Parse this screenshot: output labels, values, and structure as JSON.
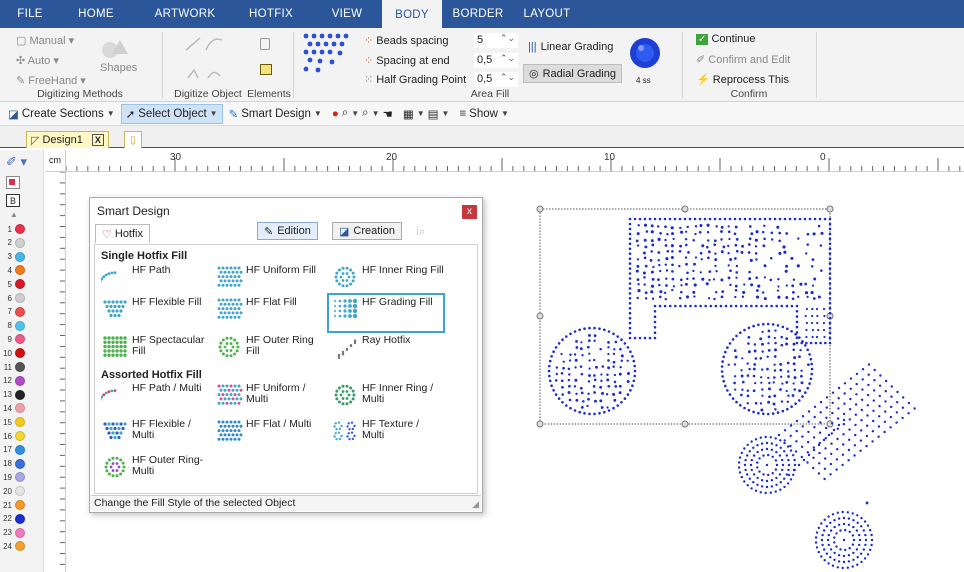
{
  "menu": {
    "tabs": [
      "FILE",
      "HOME",
      "ARTWORK",
      "HOTFIX",
      "VIEW",
      "BODY",
      "BORDER",
      "LAYOUT"
    ],
    "active": "BODY"
  },
  "ribbon": {
    "digitizing": {
      "manual": "Manual",
      "auto": "Auto",
      "freehand": "FreeHand",
      "shapes": "Shapes",
      "label": "Digitizing Methods"
    },
    "digitize_object_label": "Digitize Object",
    "elements_label": "Elements",
    "area_fill": {
      "beads_spacing_label": "Beads spacing",
      "beads_spacing_value": "5",
      "spacing_end_label": "Spacing at end",
      "spacing_end_value": "0,5",
      "half_grading_label": "Half Grading Point",
      "half_grading_value": "0,5",
      "linear_grading": "Linear Grading",
      "radial_grading": "Radial Grading",
      "bead_size": "4 ss",
      "label": "Area Fill"
    },
    "confirm": {
      "continue": "Continue",
      "confirm_edit": "Confirm and Edit",
      "reprocess": "Reprocess This",
      "label": "Confirm"
    }
  },
  "toolbar": {
    "create_sections": "Create Sections",
    "select_object": "Select Object",
    "smart_design": "Smart Design",
    "show": "Show"
  },
  "document_tab": {
    "name": "Design1",
    "close": "X"
  },
  "ruler": {
    "unit": "cm",
    "labels": [
      "30",
      "20",
      "10",
      "0"
    ]
  },
  "color_palette": {
    "numbers": [
      "1",
      "2",
      "3",
      "4",
      "5",
      "6",
      "7",
      "8",
      "9",
      "10",
      "11",
      "12",
      "13",
      "14",
      "15",
      "16",
      "17",
      "18",
      "19",
      "20",
      "21",
      "22",
      "23",
      "24"
    ],
    "colors": [
      "#e8314b",
      "#cfcfcf",
      "#49b7e5",
      "#f07a1a",
      "#d8192a",
      "#cfcfcf",
      "#e85050",
      "#4fc2ee",
      "#ee5a8c",
      "#d01010",
      "#555555",
      "#b04ac9",
      "#222222",
      "#f2a0a8",
      "#f5c81b",
      "#f3d530",
      "#2f8fe0",
      "#3b6fe0",
      "#a8a8e8",
      "#e5e5e5",
      "#f5962a",
      "#1a2fd0",
      "#f07ac0",
      "#f3a030"
    ]
  },
  "dialog": {
    "title": "Smart Design",
    "close": "x",
    "tab": "Hotfix",
    "edition": "Edition",
    "creation": "Creation",
    "sections": [
      {
        "title": "Single Hotfix Fill",
        "items": [
          "HF Path",
          "HF Uniform Fill",
          "HF Inner Ring Fill",
          "HF Flexible Fill",
          "HF Flat Fill",
          "HF Grading Fill",
          "HF Spectacular Fill",
          "HF Outer Ring Fill",
          "Ray Hotfix"
        ]
      },
      {
        "title": "Assorted Hotfix Fill",
        "items": [
          "HF Path / Multi",
          "HF Uniform / Multi",
          "HF Inner Ring / Multi",
          "HF Flexible / Multi",
          "HF Flat / Multi",
          "HF Texture / Multi",
          "HF Outer Ring-Multi"
        ]
      }
    ],
    "selected": "HF Grading Fill",
    "status": "Change the Fill Style of the selected Object"
  },
  "colors": {
    "brand": "#2b579a",
    "selection": "#3aa3d9",
    "beads": "#1a2ad0"
  }
}
